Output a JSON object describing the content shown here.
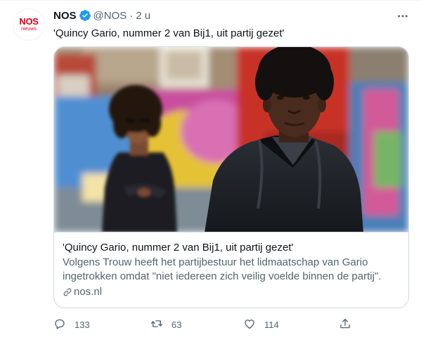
{
  "account": {
    "logo_text": "NOS",
    "logo_subtext": "nieuws",
    "display_name": "NOS",
    "handle": "@NOS",
    "separator": "·",
    "time": "2 u"
  },
  "tweet": {
    "text": "'Quincy Gario, nummer 2 van Bij1, uit partij gezet'"
  },
  "card": {
    "title": "'Quincy Gario, nummer 2 van Bij1, uit partij gezet'",
    "description_line1": "Volgens Trouw heeft het partijbestuur het lidmaatschap van Gario",
    "description_line2": "ingetrokken omdat \"niet iedereen zich veilig voelde binnen de partij\".",
    "domain": "nos.nl"
  },
  "actions": {
    "replies": "133",
    "retweets": "63",
    "likes": "114"
  },
  "colors": {
    "brand": "#e2001a",
    "verified": "#1d9bf0",
    "text_primary": "#0f1419",
    "text_secondary": "#536471",
    "border": "#cfd9de"
  },
  "icons": [
    "verified-badge-icon",
    "more-icon",
    "link-icon",
    "reply-icon",
    "retweet-icon",
    "like-icon",
    "share-icon"
  ]
}
